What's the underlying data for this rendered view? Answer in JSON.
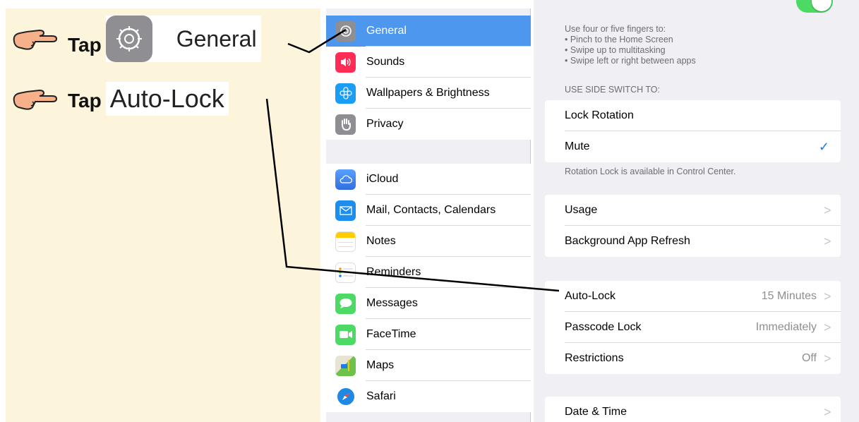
{
  "instructions": {
    "step1": {
      "tap": "Tap",
      "target": "General"
    },
    "step2": {
      "tap": "Tap",
      "target": "Auto-Lock"
    }
  },
  "sidebar": {
    "groups": [
      {
        "items": [
          {
            "label": "General",
            "icon": "gear-icon",
            "color": "#8e8e93",
            "selected": true
          },
          {
            "label": "Sounds",
            "icon": "speaker-icon",
            "color": "#ff2d55"
          },
          {
            "label": "Wallpapers & Brightness",
            "icon": "flower-icon",
            "color": "#1a9df5"
          },
          {
            "label": "Privacy",
            "icon": "hand-icon",
            "color": "#8e8e93"
          }
        ]
      },
      {
        "items": [
          {
            "label": "iCloud",
            "icon": "cloud-icon",
            "color": "#3b82f6"
          },
          {
            "label": "Mail, Contacts, Calendars",
            "icon": "envelope-icon",
            "color": "#1b8ef0"
          },
          {
            "label": "Notes",
            "icon": "notepad-icon",
            "color": "#ffcc00"
          },
          {
            "label": "Reminders",
            "icon": "list-icon",
            "color": "#ffffff"
          },
          {
            "label": "Messages",
            "icon": "speech-bubble-icon",
            "color": "#4cd964"
          },
          {
            "label": "FaceTime",
            "icon": "video-camera-icon",
            "color": "#4cd964"
          },
          {
            "label": "Maps",
            "icon": "map-icon",
            "color": "#6cc24a"
          },
          {
            "label": "Safari",
            "icon": "compass-icon",
            "color": "#1e88e5"
          }
        ]
      }
    ]
  },
  "detail": {
    "gestures_note": [
      "Use four or five fingers to:",
      "• Pinch to the Home Screen",
      "• Swipe up to multitasking",
      "• Swipe left or right between apps"
    ],
    "side_switch_header": "USE SIDE SWITCH TO:",
    "side_switch": [
      {
        "label": "Lock Rotation"
      },
      {
        "label": "Mute",
        "checked": true
      }
    ],
    "side_switch_note": "Rotation Lock is available in Control Center.",
    "usage_group": [
      {
        "label": "Usage"
      },
      {
        "label": "Background App Refresh"
      }
    ],
    "lock_group": [
      {
        "label": "Auto-Lock",
        "value": "15 Minutes"
      },
      {
        "label": "Passcode Lock",
        "value": "Immediately"
      },
      {
        "label": "Restrictions",
        "value": "Off"
      }
    ],
    "date_group": [
      {
        "label": "Date & Time"
      }
    ],
    "chevron": ">",
    "checkmark": "✓"
  },
  "colors": {
    "accent": "#1a7bf2",
    "selected_row": "#4d98ee",
    "instruction_bg": "#fdf4dc"
  }
}
